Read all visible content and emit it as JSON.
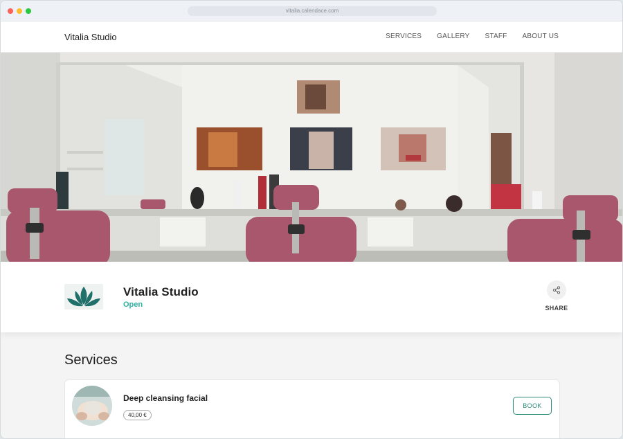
{
  "browser": {
    "url": "vitalia.calendace.com"
  },
  "header": {
    "brand": "Vitalia Studio",
    "nav": [
      "SERVICES",
      "GALLERY",
      "STAFF",
      "ABOUT US"
    ]
  },
  "profile": {
    "name": "Vitalia Studio",
    "status": "Open",
    "share_label": "SHARE"
  },
  "services": {
    "title": "Services",
    "items": [
      {
        "name": "Deep cleansing facial",
        "price": "40,00 €",
        "book_label": "BOOK"
      }
    ]
  },
  "colors": {
    "accent": "#2fb1a2",
    "book": "#2b8a78",
    "chair": "#a8576d"
  },
  "icons": {
    "share": "share-icon",
    "logo": "lotus-logo-icon"
  }
}
